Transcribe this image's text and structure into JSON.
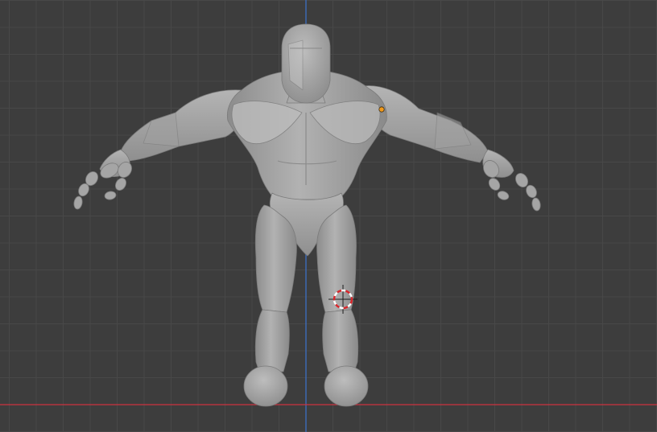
{
  "viewport": {
    "view": "front-orthographic",
    "background_color": "#3d3d3d",
    "grid": {
      "minor_color": "#484848",
      "major_color": "#505050"
    },
    "axes": {
      "x_axis_color": "#cc3340",
      "z_axis_color": "#3d6fc4"
    }
  },
  "scene": {
    "object": {
      "type": "humanoid-sculpt-mesh",
      "shading": "solid",
      "base_color": "#9e9e9e",
      "selected": false
    },
    "origin_point": {
      "color": "#f29a1c",
      "icon": "object-origin-icon"
    },
    "cursor_3d": {
      "icon": "3d-cursor-icon",
      "colors": [
        "#d9262b",
        "#ffffff"
      ]
    }
  }
}
